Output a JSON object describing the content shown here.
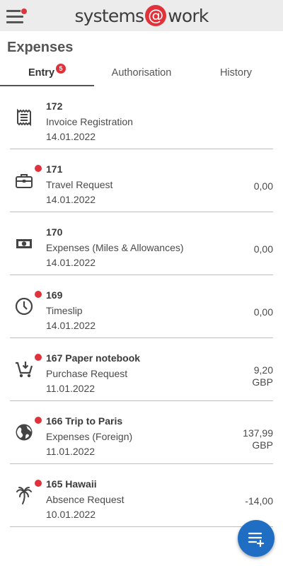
{
  "header": {
    "menu_icon": "hamburger-menu-icon",
    "menu_badge_color": "#e0323a",
    "logo": {
      "before": "systems",
      "at": "@",
      "after": "work"
    }
  },
  "page": {
    "title": "Expenses"
  },
  "tabs": [
    {
      "label": "Entry",
      "badge": "5",
      "active": true
    },
    {
      "label": "Authorisation"
    },
    {
      "label": "History"
    }
  ],
  "items": [
    {
      "number": "172",
      "title": "172",
      "type": "Invoice Registration",
      "date": "14.01.2022",
      "amount": "",
      "currency": "",
      "unread": false,
      "icon": "receipt-icon"
    },
    {
      "number": "171",
      "title": "171",
      "type": "Travel Request",
      "date": "14.01.2022",
      "amount": "0,00",
      "currency": "",
      "unread": true,
      "icon": "briefcase-icon"
    },
    {
      "number": "170",
      "title": "170",
      "type": "Expenses (Miles & Allowances)",
      "date": "14.01.2022",
      "amount": "0,00",
      "currency": "",
      "unread": false,
      "icon": "banknote-icon"
    },
    {
      "number": "169",
      "title": "169",
      "type": "Timeslip",
      "date": "14.01.2022",
      "amount": "0,00",
      "currency": "",
      "unread": true,
      "icon": "clock-icon"
    },
    {
      "number": "167",
      "title": "167 Paper notebook",
      "type": "Purchase Request",
      "date": "11.01.2022",
      "amount": "9,20",
      "currency": "GBP",
      "unread": true,
      "icon": "shopping-cart-icon"
    },
    {
      "number": "166",
      "title": "166 Trip to Paris",
      "type": "Expenses (Foreign)",
      "date": "11.01.2022",
      "amount": "137,99",
      "currency": "GBP",
      "unread": true,
      "icon": "globe-icon"
    },
    {
      "number": "165",
      "title": "165 Hawaii",
      "type": "Absence Request",
      "date": "10.01.2022",
      "amount": "-14,00",
      "currency": "",
      "unread": true,
      "icon": "palm-tree-icon"
    }
  ],
  "fab": {
    "icon": "add-list-icon",
    "color": "#1f6ec4"
  },
  "colors": {
    "accent_red": "#e0323a",
    "text": "#333333",
    "divider": "#bdbdbd"
  }
}
